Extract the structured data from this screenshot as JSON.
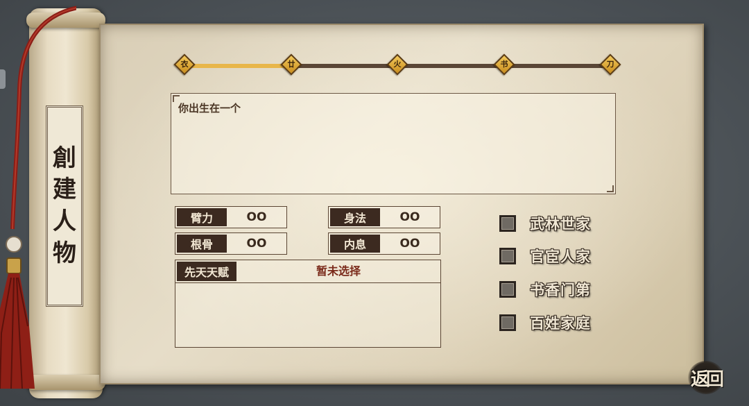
{
  "title": {
    "chars": [
      "創",
      "建",
      "人",
      "物"
    ]
  },
  "progress": {
    "steps": [
      "衣",
      "廿",
      "火",
      "书",
      "刀"
    ],
    "current_step": 1,
    "total_steps": 5,
    "fill_fraction": 0.25
  },
  "story": {
    "text": "你出生在一个"
  },
  "stats": {
    "strength": {
      "label": "臂力",
      "value": "OO"
    },
    "agility": {
      "label": "身法",
      "value": "OO"
    },
    "constitution": {
      "label": "根骨",
      "value": "OO"
    },
    "inner_breath": {
      "label": "内息",
      "value": "OO"
    }
  },
  "talent": {
    "label": "先天天赋",
    "value": "暂未选择"
  },
  "family_options": [
    {
      "label": "武林世家",
      "checked": false
    },
    {
      "label": "官宦人家",
      "checked": false
    },
    {
      "label": "书香门第",
      "checked": false
    },
    {
      "label": "百姓家庭",
      "checked": false
    }
  ],
  "back_button": {
    "label": "返回"
  },
  "colors": {
    "accent_gold": "#e8b64a",
    "dark_label": "#3c2a20",
    "talent_text": "#7a2a1a",
    "parchment": "#e6ddc8"
  },
  "icons": {
    "progress_node": "diamond-gold-icon",
    "tassel": "red-tassel-decoration"
  }
}
